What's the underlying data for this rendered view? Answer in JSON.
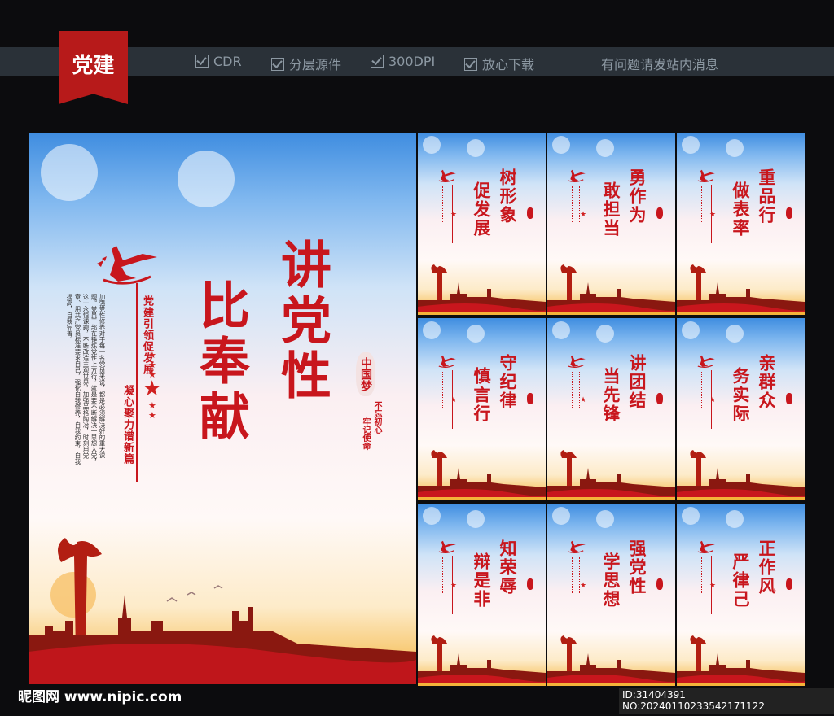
{
  "header": {
    "badge": "党建",
    "features": [
      "CDR",
      "分层源件",
      "300DPI",
      "放心下载"
    ],
    "notice": "有问题请发站内消息"
  },
  "main_poster": {
    "title_col1": "讲党性",
    "title_col2": "比奉献",
    "subtitle_col1": "党建引领促发展",
    "subtitle_col2": "凝心聚力谱新篇",
    "paragraph": [
      "加强党性修养对于每一名党员来说，都是必须",
      "解决好的重大课题。党员干部在锤炼党性上方行，就是要不断",
      "解决一思想入党，这一永恒课题，不断改造主观世界，加强品格陶冶，",
      "时刻用党章、用共产党员标准要求自己，强化自我修养，",
      "自我约束，自我提高，自我完善。"
    ],
    "seal": "中国梦",
    "motto_col1": "不忘初心",
    "motto_col2": "牢记使命"
  },
  "small_posters": [
    {
      "col1": "树形象",
      "col2": "促发展"
    },
    {
      "col1": "勇作为",
      "col2": "敢担当"
    },
    {
      "col1": "重品行",
      "col2": "做表率"
    },
    {
      "col1": "守纪律",
      "col2": "慎言行"
    },
    {
      "col1": "讲团结",
      "col2": "当先锋"
    },
    {
      "col1": "亲群众",
      "col2": "务实际"
    },
    {
      "col1": "知荣辱",
      "col2": "辩是非"
    },
    {
      "col1": "强党性",
      "col2": "学思想"
    },
    {
      "col1": "正作风",
      "col2": "严律己"
    }
  ],
  "footer": {
    "site": "昵图网 www.nipic.com",
    "id": "ID:31404391 NO:20240110233542171122"
  },
  "colors": {
    "accent_red": "#c8161d",
    "bar": "#2a3138",
    "background": "#0c0c0e"
  }
}
